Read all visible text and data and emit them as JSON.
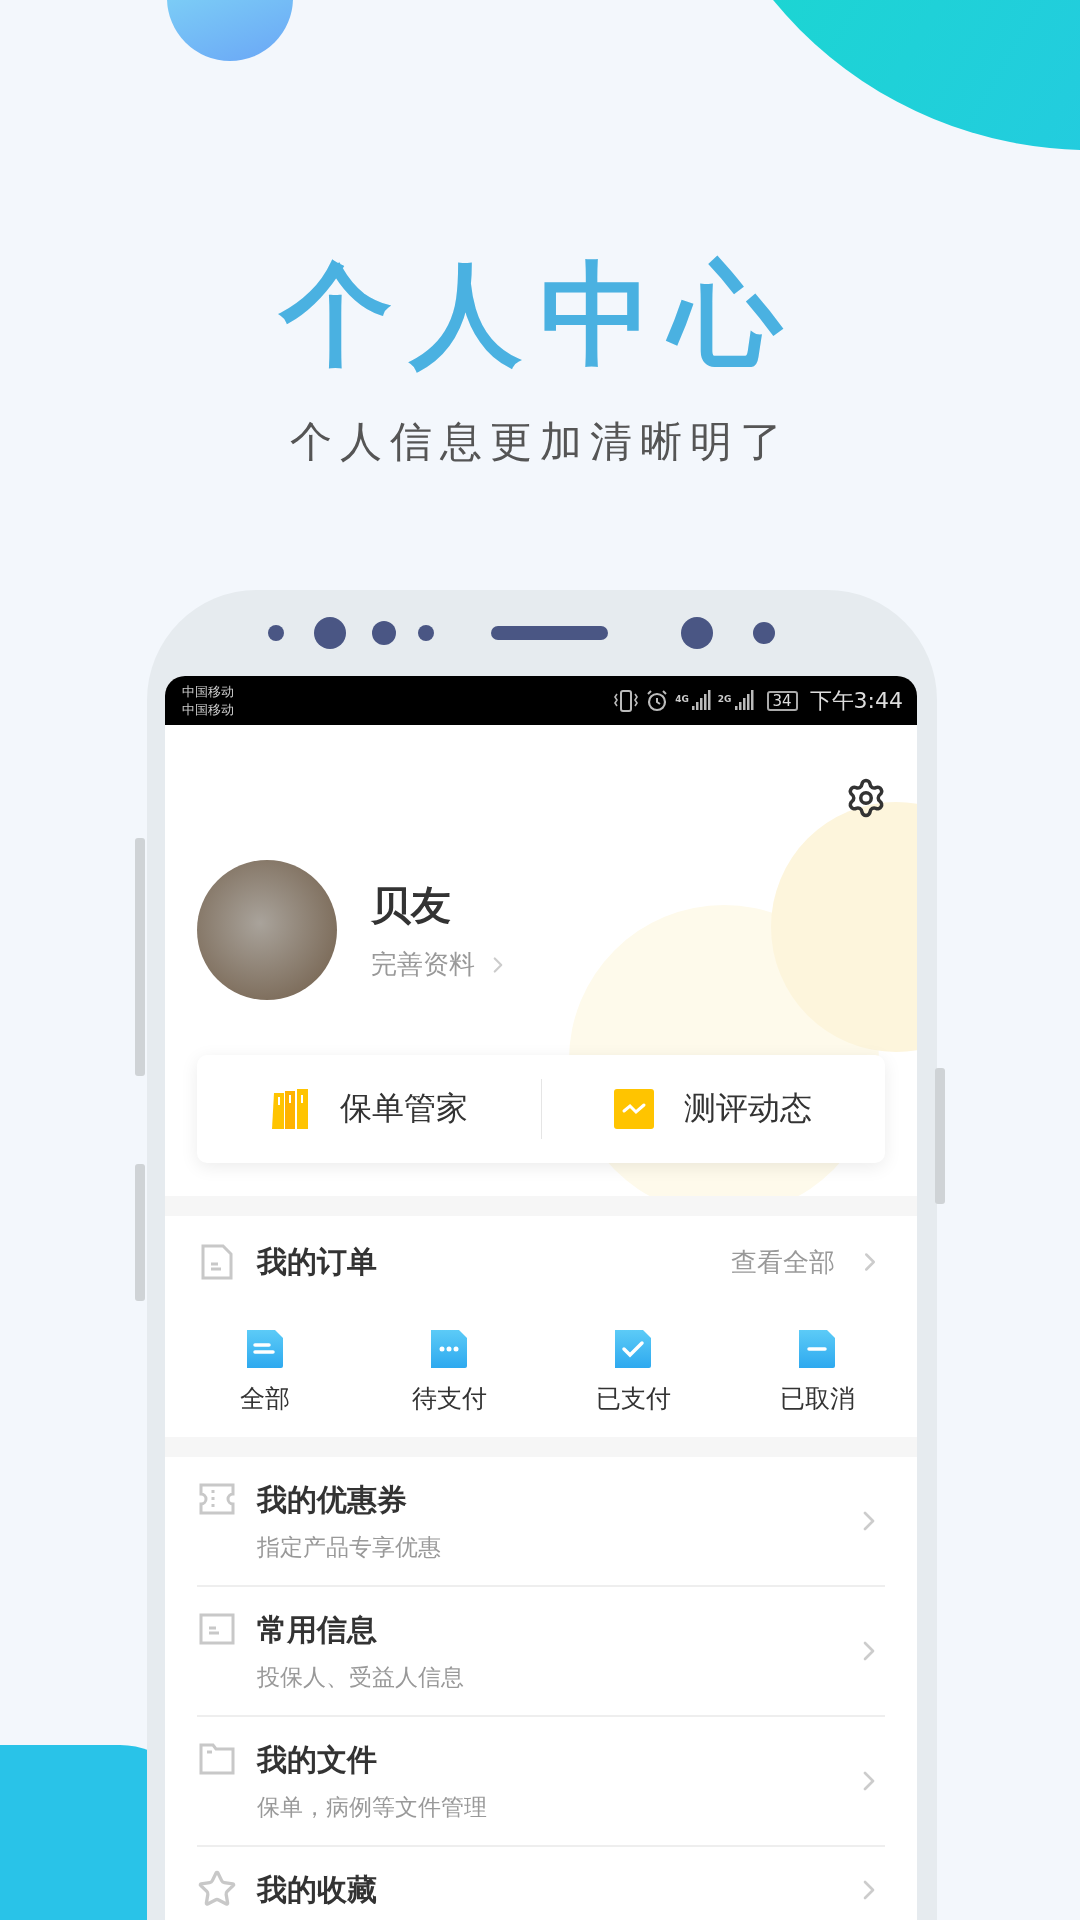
{
  "headline": "个人中心",
  "subtitle": "个人信息更加清晰明了",
  "status_bar": {
    "carriers": [
      "中国移动",
      "中国移动"
    ],
    "network_labels": [
      "4G",
      "2G"
    ],
    "battery": "34",
    "time": "下午3:44"
  },
  "profile": {
    "name": "贝友",
    "link": "完善资料"
  },
  "quick_actions": [
    {
      "label": "保单管家",
      "kind": "books"
    },
    {
      "label": "测评动态",
      "kind": "chart"
    }
  ],
  "orders": {
    "title": "我的订单",
    "view_all": "查看全部",
    "statuses": [
      {
        "label": "全部",
        "kind": "lines"
      },
      {
        "label": "待支付",
        "kind": "dots"
      },
      {
        "label": "已支付",
        "kind": "check"
      },
      {
        "label": "已取消",
        "kind": "minus"
      }
    ]
  },
  "menu": [
    {
      "title": "我的优惠券",
      "subtitle": "指定产品专享优惠",
      "kind": "ticket"
    },
    {
      "title": "常用信息",
      "subtitle": "投保人、受益人信息",
      "kind": "card"
    },
    {
      "title": "我的文件",
      "subtitle": "保单，病例等文件管理",
      "kind": "folder"
    },
    {
      "title": "我的收藏",
      "kind": "star"
    }
  ]
}
